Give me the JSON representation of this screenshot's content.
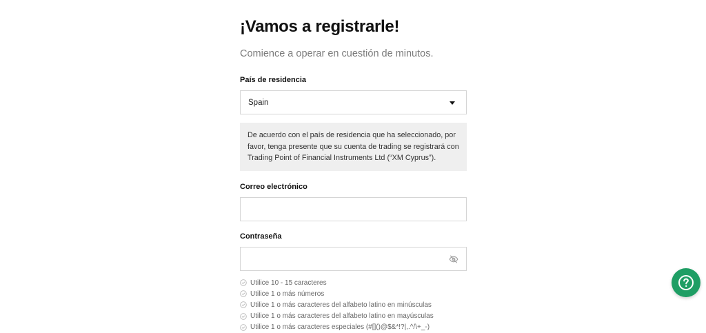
{
  "header": {
    "title": "¡Vamos a registrarle!",
    "subtitle": "Comience a operar en cuestión de minutos."
  },
  "country": {
    "label": "País de residencia",
    "value": "Spain",
    "icon": "caret-down-icon"
  },
  "notice": {
    "text": "De acuerdo con el país de residencia que ha seleccionado, por favor, tenga presente que su cuenta de trading se registrará con Trading Point of Financial Instruments Ltd (“XM Cyprus”)."
  },
  "email": {
    "label": "Correo electrónico",
    "value": ""
  },
  "password": {
    "label": "Contraseña",
    "value": "",
    "toggle_icon": "eye-off-icon",
    "rules": [
      "Utilice 10 - 15 caracteres",
      "Utilice 1 o más números",
      "Utilice 1 o más caracteres del alfabeto latino en minúsculas",
      "Utilice 1 o más caracteres del alfabeto latino en mayúsculas",
      "Utilice 1 o más caracteres especiales (#[]()@$&*!?|,.^/\\+_-)"
    ],
    "rule_icon": "circle-check-icon"
  },
  "help": {
    "icon": "question-circle-icon",
    "color": "#1e9e64"
  }
}
